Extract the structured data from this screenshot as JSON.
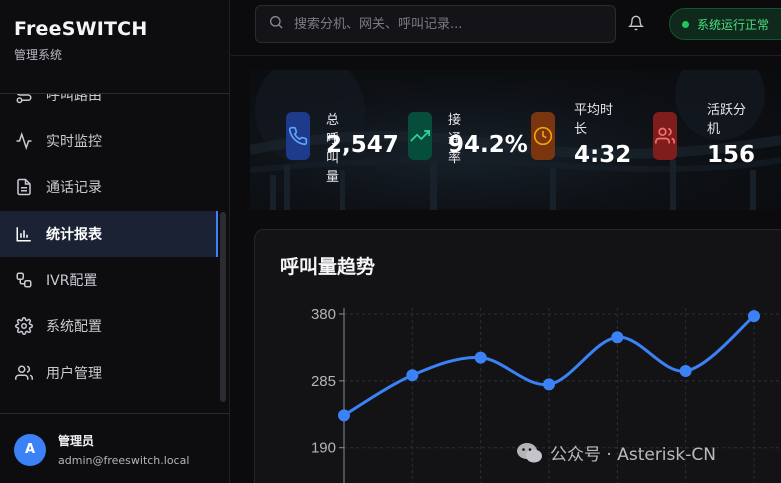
{
  "brand": {
    "title": "FreeSWITCH",
    "subtitle": "管理系统"
  },
  "nav": {
    "items": [
      {
        "label": "呼叫路由",
        "icon": "route-icon",
        "active": false
      },
      {
        "label": "实时监控",
        "icon": "activity-icon",
        "active": false
      },
      {
        "label": "通话记录",
        "icon": "file-text-icon",
        "active": false
      },
      {
        "label": "统计报表",
        "icon": "bar-chart-icon",
        "active": true
      },
      {
        "label": "IVR配置",
        "icon": "workflow-icon",
        "active": false
      },
      {
        "label": "系统配置",
        "icon": "gear-icon",
        "active": false
      },
      {
        "label": "用户管理",
        "icon": "users-icon",
        "active": false
      }
    ]
  },
  "user": {
    "initial": "A",
    "name": "管理员",
    "email": "admin@freeswitch.local"
  },
  "header": {
    "search_placeholder": "搜索分机、网关、呼叫记录...",
    "status_text": "系统运行正常"
  },
  "stats": [
    {
      "label": "总呼叫量",
      "value": "2,547",
      "icon": "phone-icon",
      "color": "#60a5fa",
      "bg": "#1e3a8a"
    },
    {
      "label": "接通率",
      "value": "94.2%",
      "icon": "trending-up-icon",
      "color": "#34d399",
      "bg": "#064e3b"
    },
    {
      "label": "平均时长",
      "value": "4:32",
      "icon": "clock-icon",
      "color": "#f59e0b",
      "bg": "#78350f"
    },
    {
      "label": "活跃分机",
      "value": "156",
      "icon": "users-icon",
      "color": "#f87171",
      "bg": "#7f1d1d"
    }
  ],
  "chart_card": {
    "title": "呼叫量趋势"
  },
  "chart_data": {
    "type": "line",
    "title": "呼叫量趋势",
    "x_index": [
      0,
      1,
      2,
      3,
      4,
      5,
      6
    ],
    "values": [
      236,
      293,
      318,
      280,
      347,
      299,
      377
    ],
    "y_ticks": [
      380,
      285,
      190
    ],
    "ylim": [
      110,
      380
    ],
    "grid": true,
    "line_color": "#3b82f6"
  },
  "watermark": {
    "text": "公众号 · Asterisk-CN"
  }
}
